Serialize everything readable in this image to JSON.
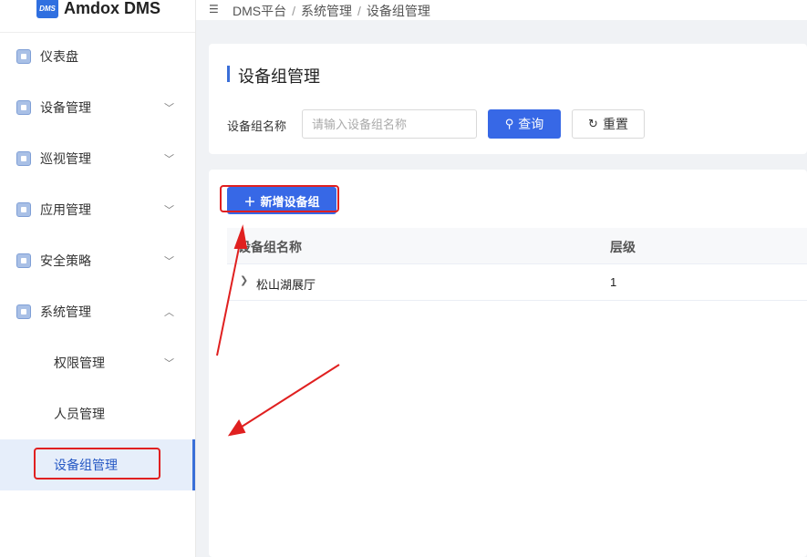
{
  "brand": {
    "logo": "DMS",
    "name": "Amdox DMS"
  },
  "sidebar": {
    "items": [
      {
        "label": "仪表盘",
        "icon": "dashboard-icon"
      },
      {
        "label": "设备管理",
        "icon": "device-icon"
      },
      {
        "label": "巡视管理",
        "icon": "patrol-icon"
      },
      {
        "label": "应用管理",
        "icon": "app-icon"
      },
      {
        "label": "安全策略",
        "icon": "security-icon"
      },
      {
        "label": "系统管理",
        "icon": "system-icon"
      }
    ],
    "sub_items": [
      {
        "label": "权限管理"
      },
      {
        "label": "人员管理"
      },
      {
        "label": "设备组管理"
      }
    ]
  },
  "header": {
    "breadcrumb": [
      "DMS平台",
      "系统管理",
      "设备组管理"
    ],
    "separator": "/"
  },
  "search": {
    "title": "设备组管理",
    "field_label": "设备组名称",
    "placeholder": "请输入设备组名称",
    "value": "",
    "query_label": "查询",
    "reset_label": "重置"
  },
  "table": {
    "add_label": "新增设备组",
    "columns": [
      "设备组名称",
      "层级"
    ],
    "rows": [
      {
        "name": "松山湖展厅",
        "level": "1"
      }
    ]
  },
  "colors": {
    "primary": "#3768e6",
    "annotation": "#e02020",
    "active_bg": "#e6eefa"
  }
}
